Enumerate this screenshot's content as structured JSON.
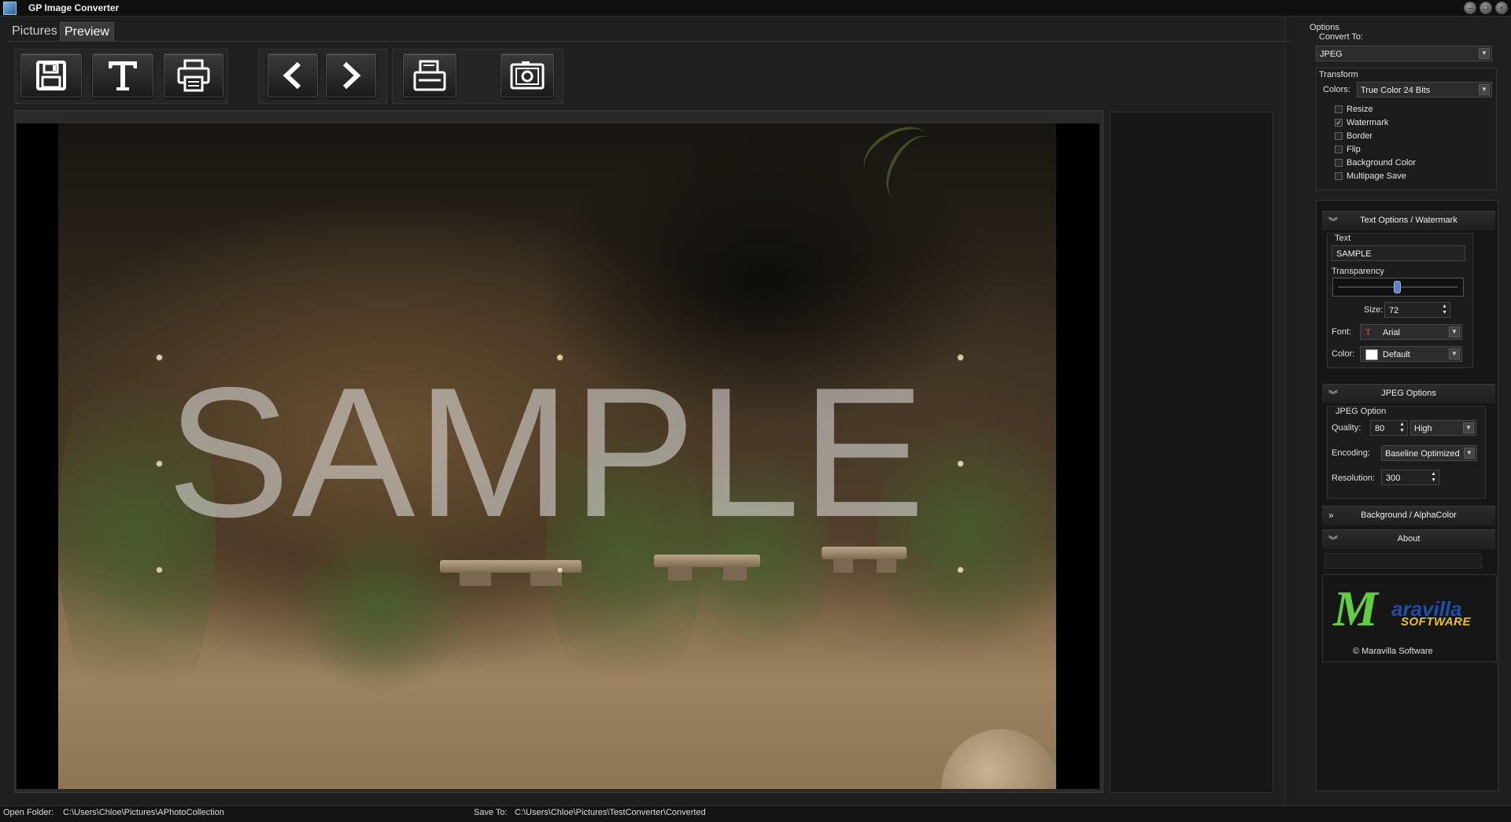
{
  "window": {
    "title": "GP Image Converter",
    "buttons": [
      "minimize",
      "maximize",
      "close"
    ]
  },
  "tabs": [
    {
      "label": "Pictures",
      "active": false
    },
    {
      "label": "Preview",
      "active": true
    }
  ],
  "toolbar": {
    "buttons": [
      {
        "name": "save",
        "icon": "floppy-disk-icon"
      },
      {
        "name": "text",
        "icon": "text-t-icon"
      },
      {
        "name": "print",
        "icon": "printer-icon"
      },
      {
        "name": "previous",
        "icon": "chevron-left-icon"
      },
      {
        "name": "next",
        "icon": "chevron-right-icon"
      },
      {
        "name": "scan",
        "icon": "scanner-icon"
      },
      {
        "name": "camera",
        "icon": "camera-icon"
      }
    ]
  },
  "preview": {
    "watermark_text": "SAMPLE"
  },
  "options": {
    "header": "Options",
    "convert_to_label": "Convert To:",
    "convert_to_value": "JPEG",
    "transform_label": "Transform",
    "colors_label": "Colors:",
    "colors_value": "True Color 24 Bits",
    "checkboxes": [
      {
        "label": "Resize",
        "checked": false
      },
      {
        "label": "Watermark",
        "checked": true
      },
      {
        "label": "Border",
        "checked": false
      },
      {
        "label": "Flip",
        "checked": false
      },
      {
        "label": "Background Color",
        "checked": false
      },
      {
        "label": "Multipage Save",
        "checked": false
      }
    ]
  },
  "text_options": {
    "title": "Text Options / Watermark",
    "text_label": "Text",
    "text_value": "SAMPLE",
    "transparency_label": "Transparency",
    "transparency_value": 0.47,
    "size_label": "Size:",
    "size_value": "72",
    "font_label": "Font:",
    "font_value": "Arial",
    "color_label": "Color:",
    "color_value": "Default",
    "color_swatch": "#ffffff"
  },
  "jpeg_options": {
    "title": "JPEG Options",
    "group_label": "JPEG Option",
    "quality_label": "Quality:",
    "quality_value": "80",
    "quality_preset": "High",
    "encoding_label": "Encoding:",
    "encoding_value": "Baseline Optimized",
    "resolution_label": "Resolution:",
    "resolution_value": "300"
  },
  "background_section": {
    "title": "Background / AlphaColor"
  },
  "about": {
    "title": "About",
    "logo_letter": "M",
    "logo_line1": "aravilla",
    "logo_line2": "SOFTWARE",
    "copyright": "© Maravilla Software"
  },
  "status": {
    "open_folder_label": "Open Folder:",
    "open_folder_path": "C:\\Users\\Chloe\\Pictures\\APhotoCollection",
    "save_to_label": "Save To:",
    "save_to_path": "C:\\Users\\Chloe\\Pictures\\TestConverter\\Converted"
  },
  "colors": {
    "accent_logo_green": "#5fcf3f",
    "accent_logo_blue": "#1e4fa8",
    "accent_logo_yellow": "#e7c21e",
    "slider_thumb": "#5b82c9"
  }
}
